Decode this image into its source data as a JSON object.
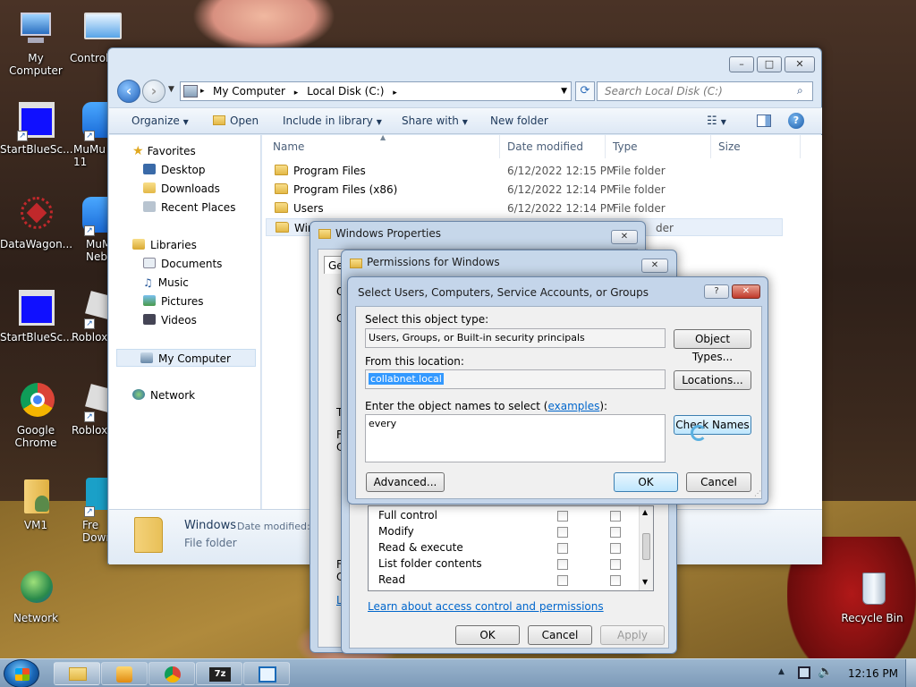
{
  "desktop": {
    "icons": [
      {
        "label": "My Computer",
        "name": "desktop-icon-my-computer"
      },
      {
        "label": "Control",
        "name": "desktop-icon-control-panel"
      },
      {
        "label": "StartBlueSc...",
        "name": "desktop-icon-startbluescreen-1"
      },
      {
        "label": "MuMu 11",
        "name": "desktop-icon-mumu-11"
      },
      {
        "label": "DataWagon...",
        "name": "desktop-icon-datawagon"
      },
      {
        "label": "MuMu Neb",
        "name": "desktop-icon-mumu-neb"
      },
      {
        "label": "StartBlueSc...",
        "name": "desktop-icon-startbluescreen-2"
      },
      {
        "label": "Roblox",
        "name": "desktop-icon-roblox-1"
      },
      {
        "label": "Google Chrome",
        "name": "desktop-icon-google-chrome"
      },
      {
        "label": "Roblox",
        "name": "desktop-icon-roblox-2"
      },
      {
        "label": "VM1",
        "name": "desktop-icon-vm1"
      },
      {
        "label": "Fre Down",
        "name": "desktop-icon-free-download"
      },
      {
        "label": "Network",
        "name": "desktop-icon-network"
      },
      {
        "label": "Recycle Bin",
        "name": "desktop-icon-recycle-bin"
      }
    ]
  },
  "explorer": {
    "window_controls": {
      "minimize": "–",
      "maximize": "□",
      "close": "✕"
    },
    "breadcrumb": [
      "My Computer",
      "Local Disk (C:)"
    ],
    "breadcrumb_sep": "▸",
    "search_placeholder": "Search Local Disk (C:)",
    "toolbar": {
      "organize": "Organize",
      "open": "Open",
      "include": "Include in library",
      "share": "Share with",
      "new_folder": "New folder"
    },
    "nav": {
      "favorites": "Favorites",
      "desktop": "Desktop",
      "downloads": "Downloads",
      "recent": "Recent Places",
      "libraries": "Libraries",
      "documents": "Documents",
      "music": "Music",
      "pictures": "Pictures",
      "videos": "Videos",
      "my_computer": "My Computer",
      "network": "Network"
    },
    "columns": {
      "name": "Name",
      "date": "Date modified",
      "type": "Type",
      "size": "Size"
    },
    "files": [
      {
        "name": "Program Files",
        "date": "6/12/2022 12:15 PM",
        "type": "File folder"
      },
      {
        "name": "Program Files (x86)",
        "date": "6/12/2022 12:14 PM",
        "type": "File folder"
      },
      {
        "name": "Users",
        "date": "6/12/2022 12:14 PM",
        "type": "File folder"
      },
      {
        "name": "Win",
        "date": "",
        "type": "der"
      }
    ],
    "details": {
      "name": "Windows",
      "date_label": "Date modified:",
      "type": "File folder"
    }
  },
  "windows_properties": {
    "title": "Windows Properties",
    "tab": "Ge",
    "side_letters": [
      "O",
      "G",
      "T",
      "F",
      "C",
      "F",
      "C",
      "L"
    ]
  },
  "permissions": {
    "title": "Permissions for Windows",
    "rows": [
      "Full control",
      "Modify",
      "Read & execute",
      "List folder contents",
      "Read"
    ],
    "link": "Learn about access control and permissions",
    "ok": "OK",
    "cancel": "Cancel",
    "apply": "Apply"
  },
  "select_dialog": {
    "title": "Select Users, Computers, Service Accounts, or Groups",
    "help": "?",
    "object_type_label": "Select this object type:",
    "object_type_value": "Users, Groups, or Built-in security principals",
    "object_types_btn": "Object Types...",
    "location_label": "From this location:",
    "location_value": "collabnet.local",
    "locations_btn": "Locations...",
    "names_label_pre": "Enter the object names to select (",
    "names_link": "examples",
    "names_label_post": "):",
    "names_value": "every",
    "check_names_btn": "Check Names",
    "advanced_btn": "Advanced...",
    "ok": "OK",
    "cancel": "Cancel"
  },
  "taskbar": {
    "time": "12:16 PM",
    "app_7z": "7z"
  }
}
